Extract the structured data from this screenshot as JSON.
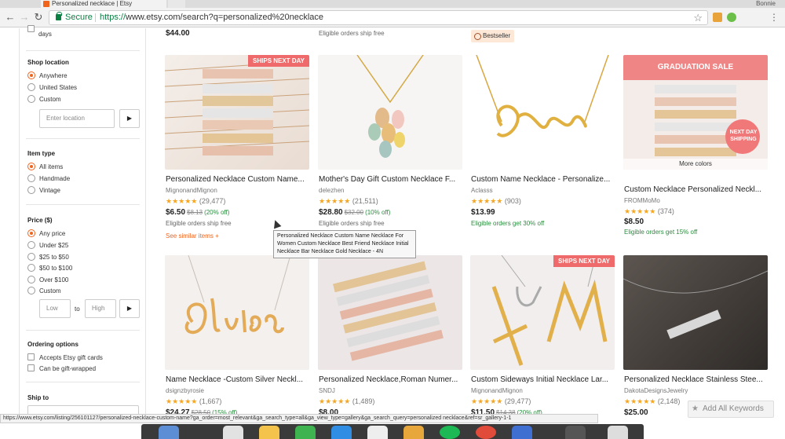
{
  "browser": {
    "tab_title": "Personalized necklace | Etsy",
    "user": "Bonnie",
    "secure_label": "Secure",
    "url_proto": "https://",
    "url_rest": "www.etsy.com/search?q=personalized%20necklace"
  },
  "sidebar": {
    "days_label": "days",
    "shop_location": {
      "title": "Shop location",
      "options": [
        "Anywhere",
        "United States",
        "Custom"
      ],
      "input_placeholder": "Enter location",
      "go": "▶"
    },
    "item_type": {
      "title": "Item type",
      "options": [
        "All items",
        "Handmade",
        "Vintage"
      ]
    },
    "price": {
      "title": "Price ($)",
      "options": [
        "Any price",
        "Under $25",
        "$25 to $50",
        "$50 to $100",
        "Over $100",
        "Custom"
      ],
      "low_placeholder": "Low",
      "to": "to",
      "high_placeholder": "High",
      "go": "▶"
    },
    "ordering": {
      "title": "Ordering options",
      "options": [
        "Accepts Etsy gift cards",
        "Can be gift-wrapped"
      ]
    },
    "ship_to": {
      "title": "Ship to"
    }
  },
  "top_row": {
    "price1": "$44.00",
    "note2": "Eligible orders ship free",
    "bestseller": "Bestseller"
  },
  "listings": [
    {
      "title": "Personalized Necklace Custom Name...",
      "shop": "MignonandMignon",
      "stars": "★★★★★",
      "reviews": "(29,477)",
      "price": "$6.50",
      "orig": "$8.13",
      "pct": "(20% off)",
      "note": "Eligible orders ship free",
      "similar": "See similar items +",
      "badge": "SHIPS NEXT DAY"
    },
    {
      "title": "Mother's Day Gift Custom Necklace F...",
      "shop": "delezhen",
      "stars": "★★★★★",
      "reviews": "(21,511)",
      "price": "$28.80",
      "orig": "$32.00",
      "pct": "(10% off)",
      "note": "Eligible orders ship free"
    },
    {
      "title": "Custom Name Necklace - Personalize...",
      "shop": "Aclasss",
      "stars": "★★★★★",
      "reviews": "(903)",
      "price": "$13.99",
      "note": "Eligible orders get 30% off"
    },
    {
      "title": "Custom Necklace Personalized Neckl...",
      "shop": "FROMMoMo",
      "stars": "★★★★★",
      "reviews": "(374)",
      "price": "$8.50",
      "note": "Eligible orders get 15% off",
      "more_colors": "More colors",
      "banner": "GRADUATION SALE",
      "next_day": "NEXT DAY SHIPPING"
    },
    {
      "title": "Name Necklace -Custom Silver Neckl...",
      "shop": "dsignzbyrosie",
      "stars": "★★★★★",
      "reviews": "(1,667)",
      "price": "$24.27",
      "orig": "$28.50",
      "pct": "(15% off)"
    },
    {
      "title": "Personalized Necklace,Roman Numer...",
      "shop": "SNDJ",
      "stars": "★★★★★",
      "reviews": "(1,489)",
      "price": "$8.00"
    },
    {
      "title": "Custom Sideways Initial Necklace Lar...",
      "shop": "MignonandMignon",
      "stars": "★★★★★",
      "reviews": "(29,477)",
      "price": "$11.50",
      "orig": "$14.38",
      "pct": "(20% off)",
      "badge": "SHIPS NEXT DAY"
    },
    {
      "title": "Personalized Necklace Stainless Stee...",
      "shop": "DakotaDesignsJewelry",
      "stars": "★★★★★",
      "reviews": "(2,148)",
      "price": "$25.00"
    }
  ],
  "tooltip": "Personalized Necklace Custom Name Necklace For Women Custom Necklace Best Friend Necklace Initial Necklace Bar Necklace Gold Necklace - 4N",
  "status_url": "https://www.etsy.com/listing/256101127/personalized-necklace-custom-name?ga_order=most_relevant&ga_search_type=all&ga_view_type=gallery&ga_search_query=personalized necklace&ref=sr_gallery-1-1",
  "add_keywords": "Add All Keywords",
  "colors": {
    "accent": "#f1641e",
    "green": "#2a8c3e",
    "badge": "#ef6a6a"
  },
  "icons": [
    "back-icon",
    "forward-icon",
    "reload-icon",
    "lock-icon",
    "bookmark-star-icon",
    "menu-icon",
    "bestseller-ribbon-icon",
    "star-icon"
  ]
}
